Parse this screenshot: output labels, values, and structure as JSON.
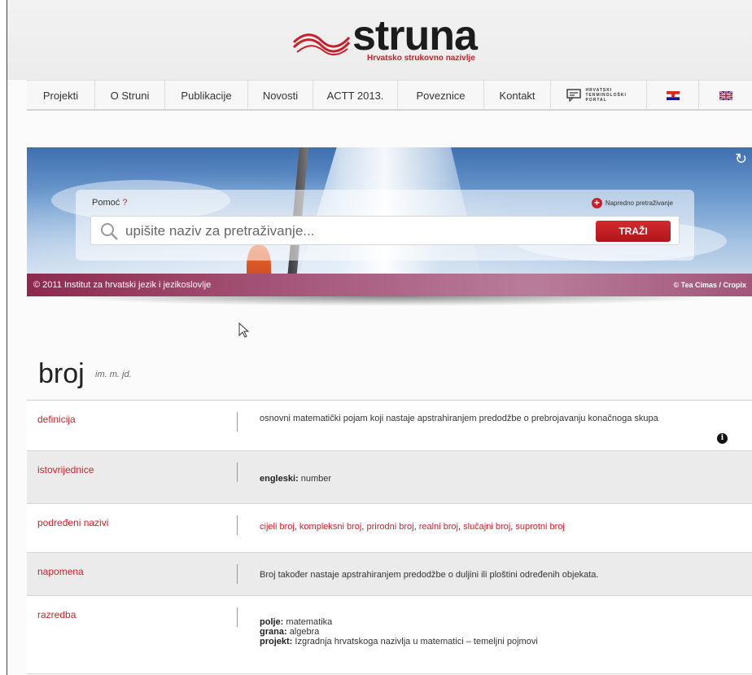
{
  "logo": {
    "wordmark": "struna",
    "tagline": "Hrvatsko strukovno nazivlje"
  },
  "nav": {
    "items": [
      {
        "label": "Projekti"
      },
      {
        "label": "O Struni"
      },
      {
        "label": "Publikacije"
      },
      {
        "label": "Novosti"
      },
      {
        "label": "ACTT 2013."
      },
      {
        "label": "Poveznice"
      },
      {
        "label": "Kontakt"
      }
    ],
    "portal_text": "HRVATSKI TERMINOLOŠKI PORTAL",
    "lang_hr_icon": "croatian-flag-icon",
    "lang_en_icon": "uk-flag-icon"
  },
  "search": {
    "help_label": "Pomoć",
    "help_q": "?",
    "advanced_label": "Napredno pretraživanje",
    "placeholder": "upišite naziv za pretraživanje...",
    "button_label": "TRAŽI"
  },
  "banner": {
    "copyright": "© 2011 Institut za hrvatski jezik i jezikoslovlje",
    "photo_credit": "© Tea Cimas / Cropix"
  },
  "term": {
    "word": "broj",
    "grammar": "im. m. jd."
  },
  "rows": [
    {
      "label": "definicija",
      "value": "osnovni matematički pojam koji nastaje apstrahiranjem predodžbe o prebrojavanju konačnoga skupa"
    },
    {
      "label": "istovrijednice",
      "key": "engleski:",
      "value": "number"
    },
    {
      "label": "podređeni nazivi",
      "links": [
        "cijeli broj",
        "kompleksni broj",
        "prirodni broj",
        "realni broj",
        "slučajni broj",
        "suprotni broj"
      ]
    },
    {
      "label": "napomena",
      "value": "Broj također nastaje apstrahiranjem predodžbe o duljini ili ploštini određenih objekata."
    },
    {
      "label": "razredba",
      "lines": [
        {
          "key": "polje:",
          "value": "matematika"
        },
        {
          "key": "grana:",
          "value": "algebra"
        },
        {
          "key": "projekt:",
          "value": "Izgradnja hrvatskoga nazivlja u matematici – temeljni pojmovi"
        }
      ]
    }
  ],
  "colors": {
    "accent_red": "#d0202a",
    "banner_footer": "#a2567a"
  }
}
